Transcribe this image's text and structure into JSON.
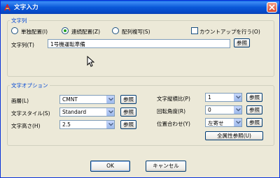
{
  "window": {
    "title": "文字入力"
  },
  "text_group": {
    "title": "文字列",
    "radio_single": "単独配置(I)",
    "radio_continuous": "連続配置(Z)",
    "radio_array": "配列複写(S)",
    "countup_label": "カウントアップを行う(O)",
    "string_label": "文字列(T)",
    "string_value": "1号機運転準備",
    "ref_label": "参照"
  },
  "options_group": {
    "title": "文字オプション",
    "layer_label": "画層(L)",
    "layer_value": "CMNT",
    "style_label": "文字スタイル(S)",
    "style_value": "Standard",
    "height_label": "文字高さ(H)",
    "height_value": "2.5",
    "ratio_label": "文字縦横比(P)",
    "ratio_value": "1",
    "angle_label": "回転角度(R)",
    "angle_value": "0",
    "align_label": "位置合わせ(Y)",
    "align_value": "左寄せ",
    "ref_label": "参照",
    "all_props_label": "全属性参照(U)"
  },
  "footer": {
    "ok_label": "OK",
    "cancel_label": "キャンセル"
  }
}
